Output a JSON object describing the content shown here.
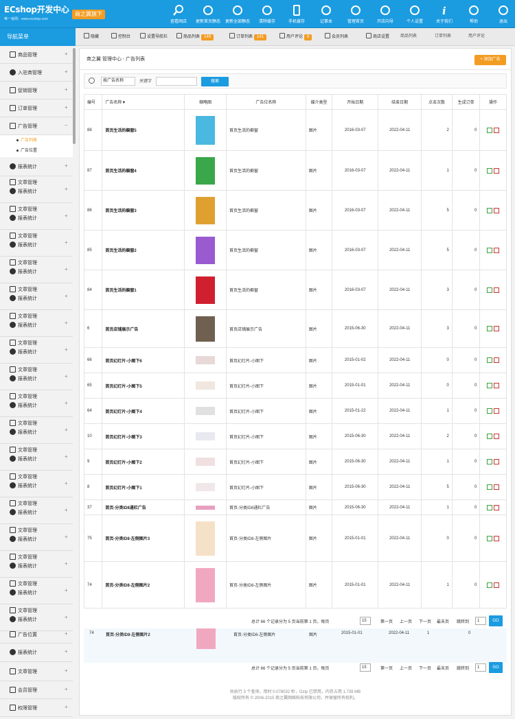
{
  "app": {
    "logo_text": "ECshop开发中心",
    "logo_sub": "唯一官网：www.ecshop.com",
    "badge": "商之翼旗下"
  },
  "topnav": [
    {
      "label": "查看网店",
      "icon": "search-icon"
    },
    {
      "label": "更新首页静态",
      "icon": "refresh-icon"
    },
    {
      "label": "更新全部静态",
      "icon": "refresh-icon"
    },
    {
      "label": "清除缓存",
      "icon": "refresh-icon"
    },
    {
      "label": "手机缓存",
      "icon": "mobile-icon"
    },
    {
      "label": "记事本",
      "icon": "pen-icon"
    },
    {
      "label": "管理首页",
      "icon": "wrench-icon"
    },
    {
      "label": "开店向导",
      "icon": "play-icon"
    },
    {
      "label": "个人设置",
      "icon": "gear-icon"
    },
    {
      "label": "关于我们",
      "icon": "info-icon"
    },
    {
      "label": "帮助",
      "icon": "help-icon"
    },
    {
      "label": "退出",
      "icon": "power-icon"
    }
  ],
  "sidebar_title": "导航菜单",
  "subnav": [
    {
      "label": "隐藏",
      "count": ""
    },
    {
      "label": "控制台",
      "count": ""
    },
    {
      "label": "设置导航栏",
      "count": ""
    },
    {
      "label": "商品列表",
      "count": "149"
    },
    {
      "label": "订单列表",
      "count": "141"
    },
    {
      "label": "用户评论",
      "count": "6"
    },
    {
      "label": "会员列表",
      "count": ""
    },
    {
      "label": "商店设置",
      "count": ""
    }
  ],
  "right_tabs": [
    "商品列表",
    "订单列表",
    "用户评论"
  ],
  "sidebar": {
    "goods": "商品管理",
    "promo": "入驻商管理",
    "promo2": "促销管理",
    "order": "订单管理",
    "ad": "广告管理",
    "ad_sub1": "广告列表",
    "ad_sub2": "广告位置",
    "stats": "报表统计",
    "article": "文章管理",
    "report": "报表统计",
    "article_last": "文章管理",
    "ad_pos": "广告位置",
    "stats_last": "报表统计",
    "article_last2": "文章管理",
    "vip": "会员管理",
    "perm": "权限管理"
  },
  "main": {
    "crumb": "商之翼 管理中心 - 广告列表",
    "add_btn": "+ 添加广告",
    "search_select": "按广告名称",
    "search_kw": "关键字",
    "search_btn": "搜索",
    "headers": [
      "编号",
      "广告名称▼",
      "缩略图",
      "广告位名称",
      "媒介类型",
      "开始日期",
      "结束日期",
      "点击次数",
      "生成订单",
      "操作"
    ],
    "rows": [
      {
        "id": "88",
        "name": "首页生活的橱窗5",
        "pos": "首页生活的橱窗",
        "type": "图片",
        "start": "2016-03-07",
        "end": "2022-04-11",
        "clicks": "2",
        "orders": "0",
        "thumb_color": "#4ab8e0"
      },
      {
        "id": "87",
        "name": "首页生活的橱窗4",
        "pos": "首页生活的橱窗",
        "type": "图片",
        "start": "2016-03-07",
        "end": "2022-04-11",
        "clicks": "1",
        "orders": "0",
        "thumb_color": "#3aa84a"
      },
      {
        "id": "86",
        "name": "首页生活的橱窗3",
        "pos": "首页生活的橱窗",
        "type": "图片",
        "start": "2016-03-07",
        "end": "2022-04-11",
        "clicks": "5",
        "orders": "0",
        "thumb_color": "#e0a030"
      },
      {
        "id": "85",
        "name": "首页生活的橱窗2",
        "pos": "首页生活的橱窗",
        "type": "图片",
        "start": "2016-03-07",
        "end": "2022-04-11",
        "clicks": "5",
        "orders": "0",
        "thumb_color": "#9a5ad0"
      },
      {
        "id": "84",
        "name": "首页生活的橱窗1",
        "pos": "首页生活的橱窗",
        "type": "图片",
        "start": "2016-03-07",
        "end": "2022-04-11",
        "clicks": "3",
        "orders": "0",
        "thumb_color": "#d02030"
      },
      {
        "id": "6",
        "name": "首页店铺展示广告",
        "pos": "首页店铺展示广告",
        "type": "图片",
        "start": "2015-06-30",
        "end": "2022-04-11",
        "clicks": "3",
        "orders": "0",
        "thumb_color": "#706050"
      },
      {
        "id": "66",
        "name": "首页幻灯片-小图下6",
        "pos": "首页幻灯片-小图下",
        "type": "图片",
        "start": "2015-01-02",
        "end": "2022-04-11",
        "clicks": "0",
        "orders": "0",
        "thumb_color": "#e8d8d8"
      },
      {
        "id": "65",
        "name": "首页幻灯片-小图下5",
        "pos": "首页幻灯片-小图下",
        "type": "图片",
        "start": "2015-01-01",
        "end": "2022-04-11",
        "clicks": "0",
        "orders": "0",
        "thumb_color": "#f0e8e0"
      },
      {
        "id": "64",
        "name": "首页幻灯片-小图下4",
        "pos": "首页幻灯片-小图下",
        "type": "图片",
        "start": "2015-01-22",
        "end": "2022-04-11",
        "clicks": "1",
        "orders": "0",
        "thumb_color": "#e0e0e0"
      },
      {
        "id": "10",
        "name": "首页幻灯片-小图下3",
        "pos": "首页幻灯片-小图下",
        "type": "图片",
        "start": "2015-06-30",
        "end": "2022-04-11",
        "clicks": "2",
        "orders": "0",
        "thumb_color": "#e8e8f0"
      },
      {
        "id": "9",
        "name": "首页幻灯片-小图下2",
        "pos": "首页幻灯片-小图下",
        "type": "图片",
        "start": "2015-06-30",
        "end": "2022-04-11",
        "clicks": "1",
        "orders": "0",
        "thumb_color": "#f0e0e0"
      },
      {
        "id": "8",
        "name": "首页幻灯片-小图下1",
        "pos": "首页幻灯片-小图下",
        "type": "图片",
        "start": "2015-06-30",
        "end": "2022-04-11",
        "clicks": "5",
        "orders": "0",
        "thumb_color": "#f0e8e8"
      },
      {
        "id": "37",
        "name": "首页-分类ID8通栏广告",
        "pos": "首页-分类ID8通栏广告",
        "type": "图片",
        "start": "2015-06-30",
        "end": "2022-04-11",
        "clicks": "1",
        "orders": "0",
        "thumb_color": "#e8a0c0"
      },
      {
        "id": "75",
        "name": "首页-分类ID8-左侧图片3",
        "pos": "首页-分类ID8-左侧图片",
        "type": "图片",
        "start": "2015-01-01",
        "end": "2022-04-11",
        "clicks": "0",
        "orders": "0",
        "thumb_color": "#f5e0c8"
      },
      {
        "id": "74",
        "name": "首页-分类ID8-左侧图片2",
        "pos": "首页-分类ID8-左侧图片",
        "type": "图片",
        "start": "2015-01-01",
        "end": "2022-04-11",
        "clicks": "1",
        "orders": "0",
        "thumb_color": "#f0a8c0"
      }
    ],
    "row_extra": {
      "id": "74",
      "name": "首页-分类ID8-左侧图片2",
      "pos": "首页-分类ID8-左侧图片",
      "type": "图片",
      "start": "2015-01-01",
      "end": "2022-04-11",
      "clicks": "1",
      "orders": "0"
    },
    "pager": {
      "total": "总计 66 个记录分为 5 页当前第 1 页，每页",
      "per_page": "15",
      "first": "第一页",
      "prev": "上一页",
      "next": "下一页",
      "last": "最末页",
      "jump": "跳转到",
      "page": "1",
      "go": "GO"
    },
    "footer1": "共执行 3 个查询，用时 0.078032 秒，Gzip 已禁用，内存占用 1.739 MB",
    "footer2": "版权所有 © 2006-2015 商之翼网络科技有限公司，并保留所有权利。"
  }
}
